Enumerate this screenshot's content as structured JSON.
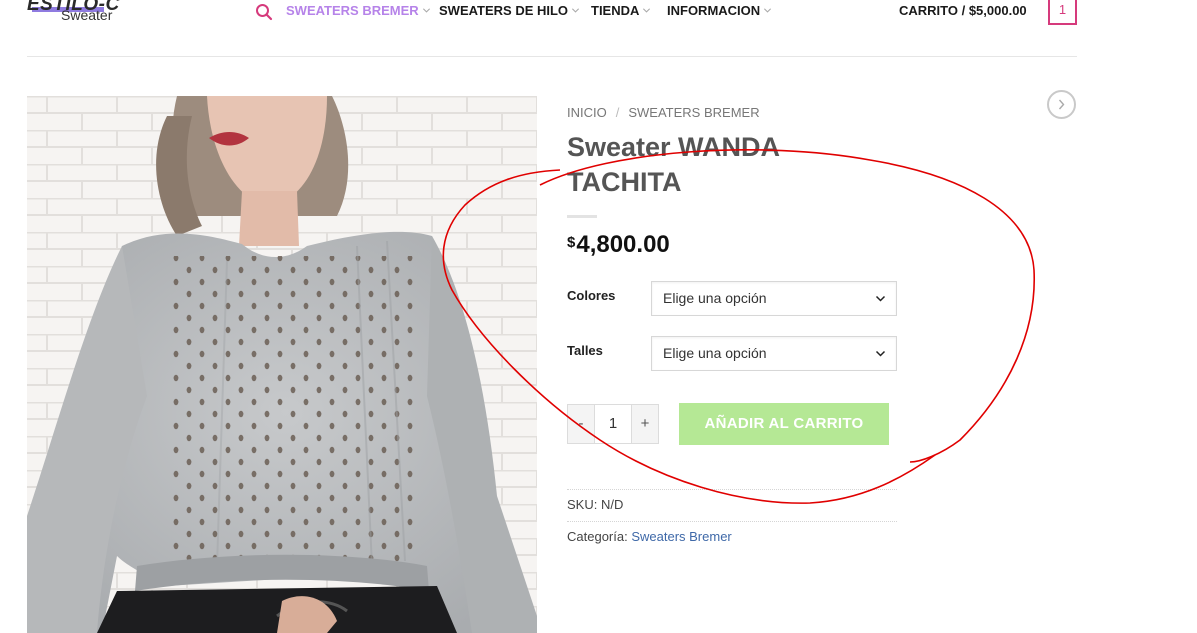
{
  "header": {
    "logo_text": "ESTILO-C",
    "logo_sub": "Sweater",
    "nav": [
      {
        "label": "SWEATERS BREMER",
        "active": true
      },
      {
        "label": "SWEATERS DE HILO",
        "active": false
      },
      {
        "label": "TIENDA",
        "active": false
      },
      {
        "label": "INFORMACION",
        "active": false
      }
    ],
    "cart_label": "CARRITO / $5,000.00",
    "cart_count": "1"
  },
  "breadcrumb": {
    "home": "INICIO",
    "separator": "/",
    "category": "SWEATERS BREMER"
  },
  "product": {
    "title": "Sweater WANDA TACHITA",
    "currency_symbol": "$",
    "price": "4,800.00",
    "attributes": [
      {
        "label": "Colores",
        "placeholder": "Elige una opción"
      },
      {
        "label": "Talles",
        "placeholder": "Elige una opción"
      }
    ],
    "quantity": {
      "minus": "-",
      "value": "1",
      "plus": "+"
    },
    "add_to_cart": "AÑADIR AL CARRITO",
    "sku_label": "SKU:",
    "sku_value": "N/D",
    "category_label": "Categoría:",
    "category_value": "Sweaters Bremer"
  },
  "colors": {
    "accent_purple": "#b683e9",
    "cart_pink": "#d63a7c",
    "add_button": "#b5e895",
    "link_blue": "#3f69a8",
    "annotation_red": "#e00000"
  },
  "icons": {
    "search": "search-icon",
    "chevron": "chevron-down-icon",
    "next": "circle-chevron-right-icon"
  }
}
